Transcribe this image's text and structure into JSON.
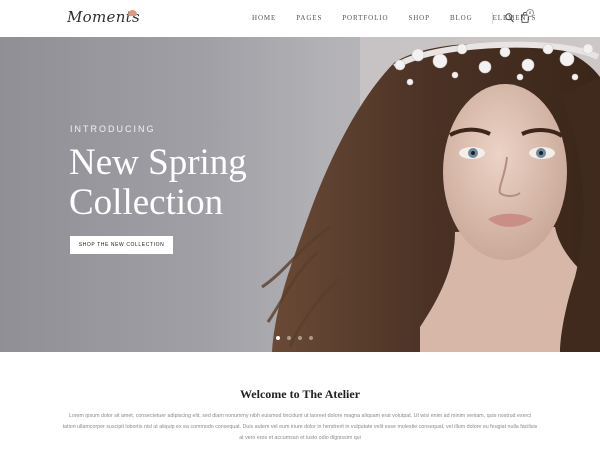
{
  "header": {
    "logo": "Moments",
    "nav": [
      "HOME",
      "PAGES",
      "PORTFOLIO",
      "SHOP",
      "BLOG",
      "ELEMENTS"
    ],
    "cart_count": "0"
  },
  "hero": {
    "eyebrow": "INTRODUCING",
    "headline": "New Spring Collection",
    "cta_label": "SHOP THE NEW COLLECTION",
    "slide_count": 4,
    "active_slide": 1
  },
  "welcome": {
    "title": "Welcome to The Atelier",
    "body": "Lorem ipsum dolor sit amet, consectetuer adipiscing elit, sed diam nonummy nibh euismod tincidunt ut laoreet dolore magna aliquam erat volutpat. Ut wisi enim ad minim veniam, quis nostrud exerci tation ullamcorper suscipit lobortis nisl ut aliquip ex ea commodo consequat. Duis autem vel eum iriure dolor in hendrerit in vulputate velit esse molestie consequat, vel illum dolore eu feugiat nulla facilisis at vero eros et accumsan et iusto odio dignissim qui"
  },
  "colors": {
    "accent": "#d99a82",
    "hero_bg": "#a4a3a8",
    "text": "#222222"
  }
}
